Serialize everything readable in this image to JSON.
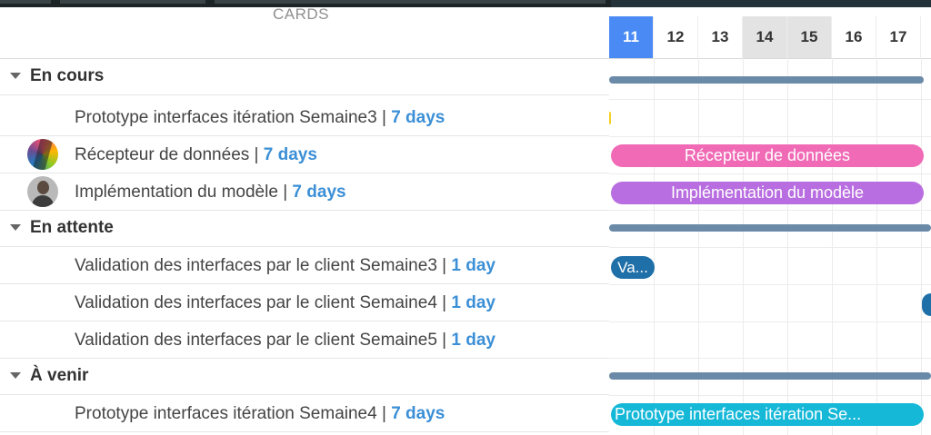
{
  "header": {
    "cards_title": "CARDS"
  },
  "timeline": {
    "days": [
      "11",
      "12",
      "13",
      "14",
      "15",
      "16",
      "17"
    ],
    "today": "11",
    "weekend": [
      "14",
      "15"
    ]
  },
  "groups": [
    {
      "label": "En cours",
      "cards": [
        {
          "title": "Prototype interfaces itération Semaine3",
          "duration": "7 days"
        },
        {
          "title": "Récepteur de données",
          "duration": "7 days",
          "avatar": "rainbow"
        },
        {
          "title": "Implémentation du modèle",
          "duration": "7 days",
          "avatar": "person"
        }
      ]
    },
    {
      "label": "En attente",
      "cards": [
        {
          "title": "Validation des interfaces par le client Semaine3",
          "duration": "1 day"
        },
        {
          "title": "Validation des interfaces par le client Semaine4",
          "duration": "1 day"
        },
        {
          "title": "Validation des interfaces par le client Semaine5",
          "duration": "1 day"
        }
      ]
    },
    {
      "label": "À venir",
      "cards": [
        {
          "title": "Prototype interfaces itération Semaine4",
          "duration": "7 days"
        }
      ]
    }
  ],
  "bars": {
    "recepteur": "Récepteur de données",
    "implementation": "Implémentation du modèle",
    "validation3": "Va...",
    "prototype4": "Prototype interfaces itération Se..."
  },
  "colors": {
    "today": "#4a8af4",
    "duration_link": "#3b8fd6",
    "group_bar": "#6b8aa8",
    "recepteur": "#f06ab5",
    "implementation": "#b86ee0",
    "validation": "#1f6fa8",
    "prototype4": "#16b8d8",
    "prototype3_sliver": "#f5d020"
  }
}
